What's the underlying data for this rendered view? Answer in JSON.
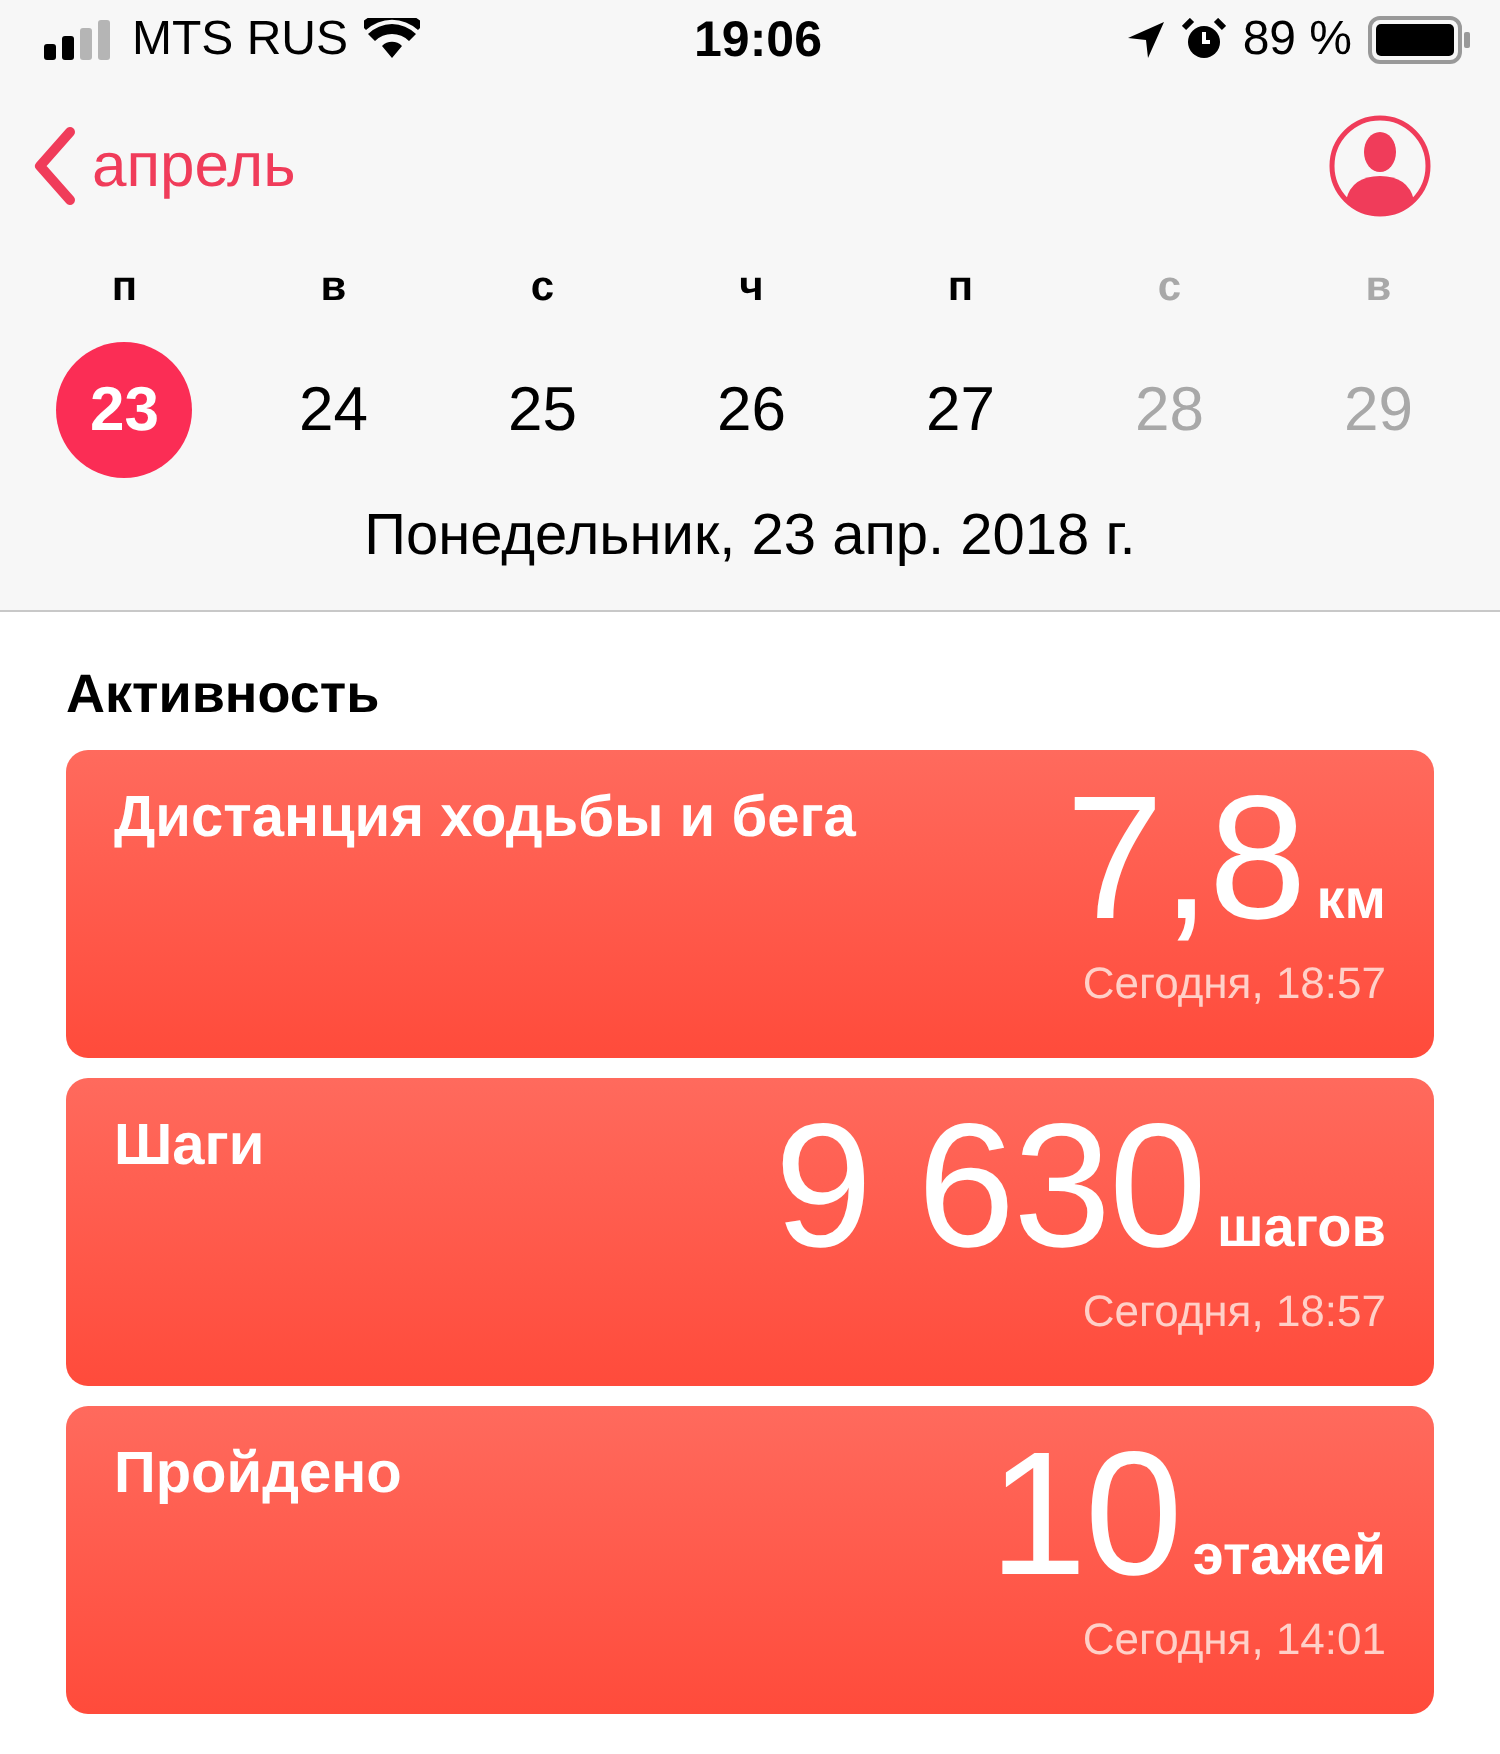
{
  "status_bar": {
    "carrier": "MTS RUS",
    "time": "19:06",
    "battery": "89 %"
  },
  "nav": {
    "back": "апрель"
  },
  "week": [
    {
      "letter": "п",
      "day": "23",
      "selected": true,
      "weekend": false
    },
    {
      "letter": "в",
      "day": "24",
      "selected": false,
      "weekend": false
    },
    {
      "letter": "с",
      "day": "25",
      "selected": false,
      "weekend": false
    },
    {
      "letter": "ч",
      "day": "26",
      "selected": false,
      "weekend": false
    },
    {
      "letter": "п",
      "day": "27",
      "selected": false,
      "weekend": false
    },
    {
      "letter": "с",
      "day": "28",
      "selected": false,
      "weekend": true
    },
    {
      "letter": "в",
      "day": "29",
      "selected": false,
      "weekend": true
    }
  ],
  "date_line": "Понедельник, 23 апр. 2018 г.",
  "section_title": "Активность",
  "cards": [
    {
      "title": "Дистанция ходьбы и бега",
      "value": "7,8",
      "unit": "км",
      "time": "Сегодня, 18:57"
    },
    {
      "title": "Шаги",
      "value": "9 630",
      "unit": "шагов",
      "time": "Сегодня, 18:57"
    },
    {
      "title": "Пройдено",
      "value": "10",
      "unit": "этажей",
      "time": "Сегодня, 14:01"
    }
  ]
}
